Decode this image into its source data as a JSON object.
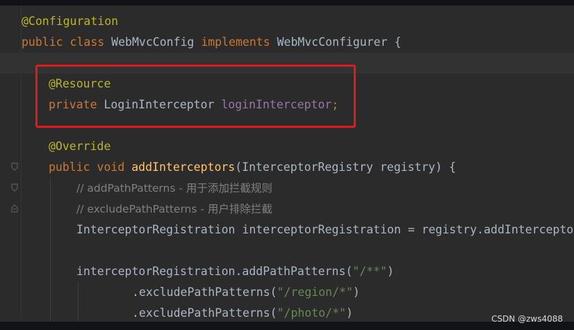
{
  "code": {
    "line1": {
      "annotation": "@Configuration"
    },
    "line2": {
      "kw_public": "public",
      "kw_class": "class",
      "class_name": "WebMvcConfig",
      "kw_implements": "implements",
      "interface_name": "WebMvcConfigurer",
      "brace": "{"
    },
    "line4": {
      "annotation": "@Resource"
    },
    "line5": {
      "kw_private": "private",
      "type": "LoginInterceptor",
      "field": "loginInterceptor",
      "semi": ";"
    },
    "line7": {
      "annotation": "@Override"
    },
    "line8": {
      "kw_public": "public",
      "kw_void": "void",
      "method": "addInterceptors",
      "params": "(InterceptorRegistry registry) {"
    },
    "line9": {
      "comment": "// addPathPatterns - 用于添加拦截规则"
    },
    "line10": {
      "comment": "// excludePathPatterns - 用户排除拦截"
    },
    "line11": {
      "text": "InterceptorRegistration interceptorRegistration = registry.addInterceptor("
    },
    "line13": {
      "prefix": "interceptorRegistration.addPathPatterns(",
      "string": "\"/**\"",
      "suffix": ")"
    },
    "line14": {
      "prefix": ".excludePathPatterns(",
      "string": "\"/region/*\"",
      "suffix": ")"
    },
    "line15": {
      "prefix": ".excludePathPatterns(",
      "string": "\"/photo/*\"",
      "suffix": ")"
    }
  },
  "watermark": "CSDN @zws4088",
  "colors": {
    "background": "#2b2b2b",
    "keyword": "#cc7832",
    "annotation": "#bbb529",
    "field": "#9876aa",
    "method": "#ffc66d",
    "string": "#6a8759",
    "comment": "#808080",
    "highlight_box": "#e3191d"
  }
}
